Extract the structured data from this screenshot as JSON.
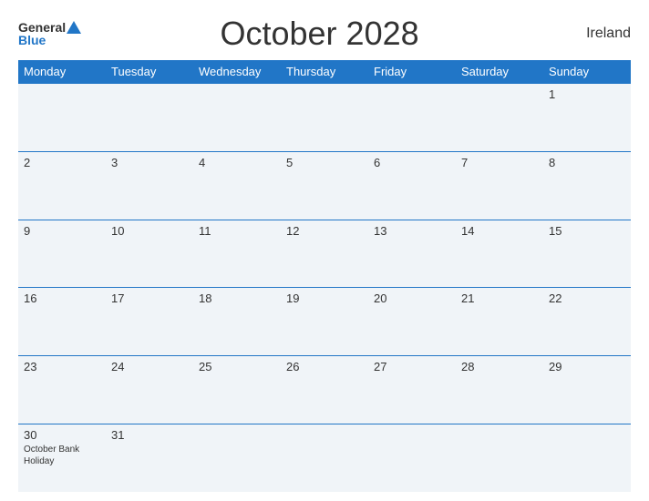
{
  "header": {
    "title": "October 2028",
    "country": "Ireland",
    "logo_general": "General",
    "logo_blue": "Blue"
  },
  "days_of_week": [
    "Monday",
    "Tuesday",
    "Wednesday",
    "Thursday",
    "Friday",
    "Saturday",
    "Sunday"
  ],
  "weeks": [
    [
      {
        "day": "",
        "holiday": ""
      },
      {
        "day": "",
        "holiday": ""
      },
      {
        "day": "",
        "holiday": ""
      },
      {
        "day": "",
        "holiday": ""
      },
      {
        "day": "",
        "holiday": ""
      },
      {
        "day": "",
        "holiday": ""
      },
      {
        "day": "1",
        "holiday": ""
      }
    ],
    [
      {
        "day": "2",
        "holiday": ""
      },
      {
        "day": "3",
        "holiday": ""
      },
      {
        "day": "4",
        "holiday": ""
      },
      {
        "day": "5",
        "holiday": ""
      },
      {
        "day": "6",
        "holiday": ""
      },
      {
        "day": "7",
        "holiday": ""
      },
      {
        "day": "8",
        "holiday": ""
      }
    ],
    [
      {
        "day": "9",
        "holiday": ""
      },
      {
        "day": "10",
        "holiday": ""
      },
      {
        "day": "11",
        "holiday": ""
      },
      {
        "day": "12",
        "holiday": ""
      },
      {
        "day": "13",
        "holiday": ""
      },
      {
        "day": "14",
        "holiday": ""
      },
      {
        "day": "15",
        "holiday": ""
      }
    ],
    [
      {
        "day": "16",
        "holiday": ""
      },
      {
        "day": "17",
        "holiday": ""
      },
      {
        "day": "18",
        "holiday": ""
      },
      {
        "day": "19",
        "holiday": ""
      },
      {
        "day": "20",
        "holiday": ""
      },
      {
        "day": "21",
        "holiday": ""
      },
      {
        "day": "22",
        "holiday": ""
      }
    ],
    [
      {
        "day": "23",
        "holiday": ""
      },
      {
        "day": "24",
        "holiday": ""
      },
      {
        "day": "25",
        "holiday": ""
      },
      {
        "day": "26",
        "holiday": ""
      },
      {
        "day": "27",
        "holiday": ""
      },
      {
        "day": "28",
        "holiday": ""
      },
      {
        "day": "29",
        "holiday": ""
      }
    ],
    [
      {
        "day": "30",
        "holiday": "October Bank Holiday"
      },
      {
        "day": "31",
        "holiday": ""
      },
      {
        "day": "",
        "holiday": ""
      },
      {
        "day": "",
        "holiday": ""
      },
      {
        "day": "",
        "holiday": ""
      },
      {
        "day": "",
        "holiday": ""
      },
      {
        "day": "",
        "holiday": ""
      }
    ]
  ]
}
